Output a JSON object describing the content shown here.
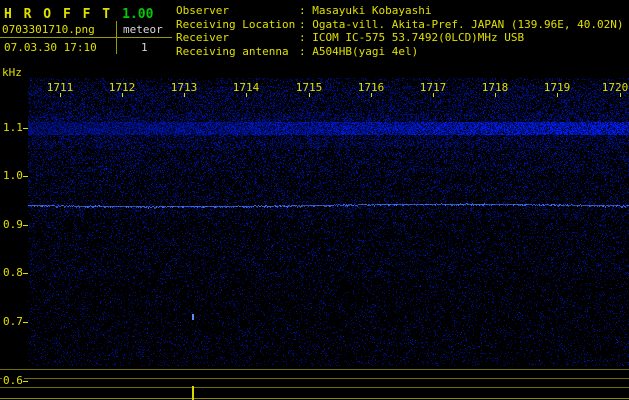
{
  "header": {
    "title": "H R O F F T",
    "version": "1.00",
    "filename": "0703301710.png",
    "meteor_label": "meteor",
    "meteor_count": "1",
    "datetime": "07.03.30 17:10",
    "info": [
      {
        "label": "Observer",
        "value": ": Masayuki Kobayashi"
      },
      {
        "label": "Receiving Location",
        "value": ": Ogata-vill. Akita-Pref. JAPAN (139.96E, 40.02N)"
      },
      {
        "label": "Receiver",
        "value": ": ICOM IC-575 53.7492(0LCD)MHz USB"
      },
      {
        "label": "Receiving antenna",
        "value": ": A504HB(yagi 4el)"
      }
    ]
  },
  "spectrogram": {
    "unit_label": "kHz",
    "freq_ticks": [
      "1.1",
      "1.0",
      "0.9",
      "0.8",
      "0.7",
      "0.6"
    ],
    "time_ticks": [
      "1711",
      "1712",
      "1713",
      "1714",
      "1715",
      "1716",
      "1717",
      "1718",
      "1719",
      "1720"
    ],
    "carrier_freq_khz": 0.95,
    "meteor_marker_time": "1713"
  },
  "colors": {
    "text_yellow": "#e0e000",
    "version_green": "#00cc00",
    "meteor_white": "#d8d8d8",
    "noise_blue": "#0000c8",
    "carrier_blue": "#4d6aff",
    "grid_olive": "#6f6f00",
    "background": "#000000"
  }
}
